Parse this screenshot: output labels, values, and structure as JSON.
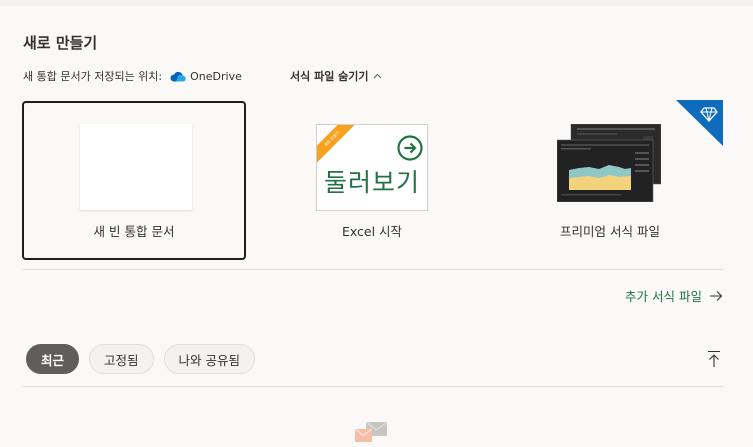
{
  "title": "새로 만들기",
  "save_location": {
    "label": "새 통합 문서가 저장되는 위치:",
    "service": "OneDrive",
    "service_icon": "onedrive-cloud-icon",
    "cloud_color": "#0364b8"
  },
  "template_toggle": {
    "label": "서식 파일 숨기기",
    "icon": "chevron-up-icon"
  },
  "templates": [
    {
      "label": "새 빈 통합 문서",
      "selected": true
    },
    {
      "label": "Excel 시작",
      "thumb_text": "둘러보기",
      "ribbon_text": "새로 만들기"
    },
    {
      "label": "프리미엄 서식 파일",
      "thumb_text": "TRACKER",
      "badge_icon": "diamond-icon"
    }
  ],
  "more_templates": {
    "label": "추가 서식 파일",
    "icon": "arrow-right-icon"
  },
  "tabs": [
    {
      "label": "최근",
      "active": true
    },
    {
      "label": "고정됨"
    },
    {
      "label": "나와 공유됨"
    }
  ],
  "sort_icon": "sort-to-top-icon",
  "colors": {
    "accent": "#217346",
    "premium": "#0f6cbd",
    "ribbon": "#f7a11c",
    "active_tab": "#605e5c"
  }
}
